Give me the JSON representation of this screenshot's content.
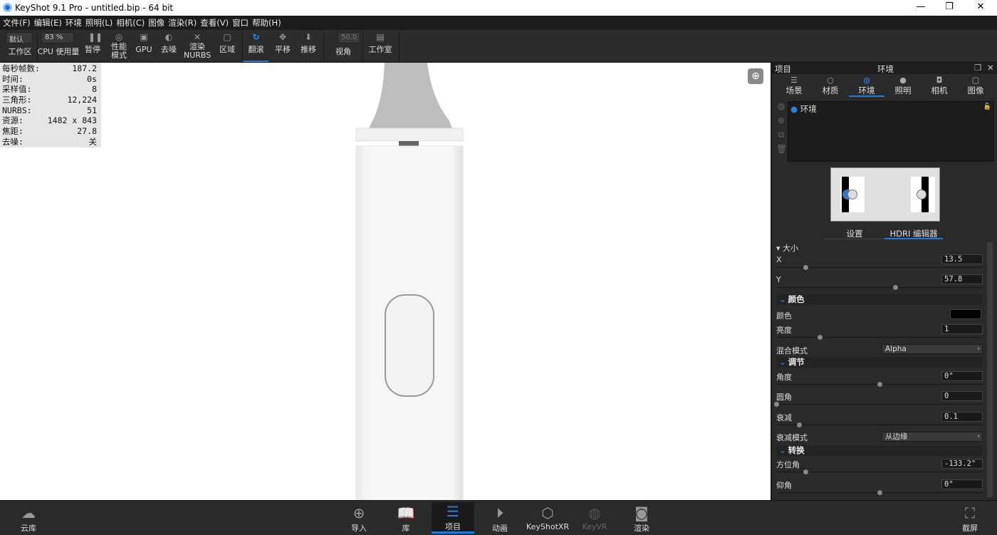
{
  "window": {
    "title": "KeyShot 9.1 Pro  - untitled.bip  - 64 bit"
  },
  "menu": [
    "文件(F)",
    "编辑(E)",
    "环境",
    "照明(L)",
    "相机(C)",
    "图像",
    "渲染(R)",
    "查看(V)",
    "窗口",
    "帮助(H)"
  ],
  "toolbar": {
    "workspace_value": "默认",
    "workspace_label": "工作区",
    "cpu_value": "83 %",
    "cpu_label_1": "CPU",
    "cpu_label_2": "使用量",
    "pause": "暂停",
    "perf_1": "性能",
    "perf_2": "模式",
    "gpu": "GPU",
    "denoise": "去噪",
    "nurbs_1": "渲染",
    "nurbs_2": "NURBS",
    "region": "区域",
    "tumble": "翻滚",
    "pan": "平移",
    "dolly": "推移",
    "fov_value": "50.0",
    "fov_label": "视角",
    "studio": "工作室"
  },
  "stats": [
    {
      "label": "每秒帧数:",
      "value": "187.2"
    },
    {
      "label": "时间:",
      "value": "0s"
    },
    {
      "label": "采样值:",
      "value": "8"
    },
    {
      "label": "三角形:",
      "value": "12,224"
    },
    {
      "label": "NURBS:",
      "value": "51"
    },
    {
      "label": "资源:",
      "value": "1482 x 843"
    },
    {
      "label": "焦距:",
      "value": "27.8"
    },
    {
      "label": "去噪:",
      "value": "关"
    }
  ],
  "panel": {
    "left_title": "项目",
    "title": "环境",
    "tabs": [
      "场景",
      "材质",
      "环境",
      "照明",
      "相机",
      "图像"
    ],
    "active_tab": 2,
    "env_item": "环境",
    "subtabs": [
      "设置",
      "HDRI 编辑器"
    ],
    "size_header": "大小",
    "x_label": "X",
    "x_value": "13.5",
    "x_slider": 0.14,
    "y_label": "Y",
    "y_value": "57.8",
    "y_slider": 0.575,
    "color_section": "颜色",
    "color_label": "颜色",
    "color_swatch": "#000000",
    "brightness_label": "亮度",
    "brightness_value": "1",
    "brightness_slider": 0.21,
    "blend_label": "混合模式",
    "blend_value": "Alpha",
    "adjust_section": "调节",
    "angle_label": "角度",
    "angle_value": "0°",
    "angle_slider": 0.5,
    "round_label": "圆角",
    "round_value": "0",
    "round_slider": 0.0,
    "falloff_label": "衰减",
    "falloff_value": "0.1",
    "falloff_slider": 0.11,
    "falloff_mode_label": "衰减模式",
    "falloff_mode_value": "从边缘",
    "transform_section": "转换",
    "azimuth_label": "方位角",
    "azimuth_value": "-133.2°",
    "azimuth_slider": 0.14,
    "elevation_label": "仰角",
    "elevation_value": "0°",
    "elevation_slider": 0.5
  },
  "bottom": {
    "cloud": "云库",
    "import": "导入",
    "library": "库",
    "project": "项目",
    "animation": "动画",
    "xr": "KeyShotXR",
    "vr": "KeyVR",
    "render": "渲染",
    "screenshot": "截屏"
  },
  "accent": "#1e7be0"
}
